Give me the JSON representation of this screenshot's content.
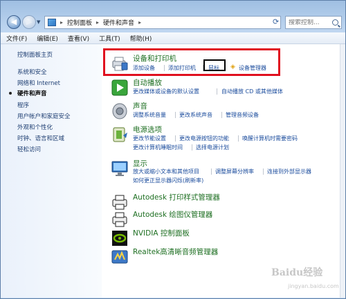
{
  "address": {
    "crumbs": [
      "控制面板",
      "硬件和声音"
    ],
    "search_placeholder": "搜索控制..."
  },
  "menu": [
    "文件(F)",
    "编辑(E)",
    "查看(V)",
    "工具(T)",
    "帮助(H)"
  ],
  "sidebar": {
    "items": [
      {
        "label": "控制面板主页",
        "active": false
      },
      {
        "label": "系统和安全",
        "active": false
      },
      {
        "label": "网络和 Internet",
        "active": false
      },
      {
        "label": "硬件和声音",
        "active": true
      },
      {
        "label": "程序",
        "active": false
      },
      {
        "label": "用户帐户和家庭安全",
        "active": false
      },
      {
        "label": "外观和个性化",
        "active": false
      },
      {
        "label": "时钟、语言和区域",
        "active": false
      },
      {
        "label": "轻松访问",
        "active": false
      }
    ]
  },
  "categories": {
    "devices": {
      "title": "设备和打印机",
      "links": [
        "添加设备",
        "添加打印机",
        "鼠标",
        "设备管理器"
      ]
    },
    "autoplay": {
      "title": "自动播放",
      "links": [
        "更改媒体或设备的默认设置",
        "自动播放 CD 或其他媒体"
      ]
    },
    "sound": {
      "title": "声音",
      "links": [
        "调整系统音量",
        "更改系统声音",
        "管理音频设备"
      ]
    },
    "power": {
      "title": "电源选项",
      "links": [
        "更改节能设置",
        "更改电源按钮的功能",
        "唤醒计算机时需要密码",
        "更改计算机睡眠时间",
        "选择电源计划"
      ]
    },
    "display": {
      "title": "显示",
      "links": [
        "放大或缩小文本和其他项目",
        "调整屏幕分辨率",
        "连接到外部显示器",
        "如何更正显示器闪烁(刷新率)"
      ]
    },
    "autodesk_plot": {
      "title": "Autodesk 打印样式管理器"
    },
    "autodesk_plotter": {
      "title": "Autodesk 绘图仪管理器"
    },
    "nvidia": {
      "title": "NVIDIA 控制面板"
    },
    "realtek": {
      "title": "Realtek高清晰音频管理器"
    }
  },
  "watermark": {
    "main": "Baidu经验",
    "sub": "jingyan.baidu.com"
  },
  "colors": {
    "highlight": "#e0101f",
    "link": "#1a4b9c",
    "title": "#1e6f22"
  }
}
